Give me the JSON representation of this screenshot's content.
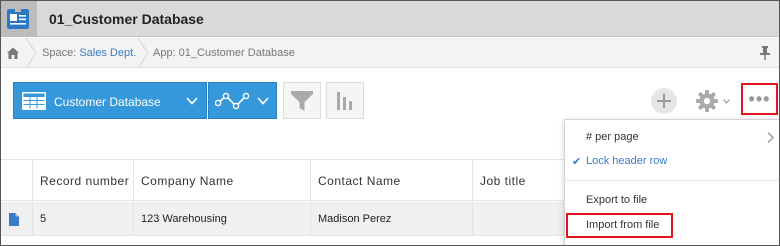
{
  "app": {
    "title": "01_Customer Database"
  },
  "breadcrumb": {
    "space_prefix": "Space: ",
    "space_name": "Sales Dept.",
    "app_label": "App: 01_Customer Database"
  },
  "toolbar": {
    "view_name": "Customer Database",
    "more_label": "•••"
  },
  "table": {
    "columns": [
      "Record number",
      "Company Name",
      "Contact Name",
      "Job title"
    ],
    "rows": [
      {
        "record_number": "5",
        "company": "123 Warehousing",
        "contact": "Madison Perez",
        "job_title": ""
      }
    ]
  },
  "menu": {
    "per_page": "# per page",
    "lock_header": "Lock header row",
    "lock_header_check": "✔",
    "export": "Export to file",
    "import": "Import from file"
  },
  "colors": {
    "accent": "#3498db",
    "highlight": "#e0161e",
    "link": "#3a7bc8"
  },
  "icons": [
    "app-icon",
    "home-icon",
    "pin-icon",
    "table-view-icon",
    "chevron-down-icon",
    "graph-icon",
    "filter-icon",
    "chart-icon",
    "plus-icon",
    "gear-icon",
    "more-icon",
    "record-icon",
    "check-icon",
    "chevron-right-icon"
  ]
}
